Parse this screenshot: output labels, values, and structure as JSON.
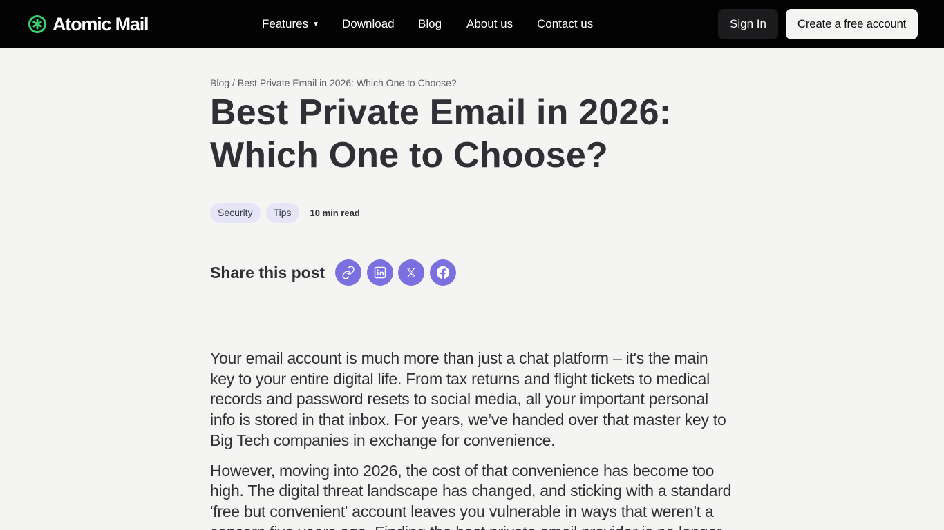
{
  "header": {
    "brand_name": "Atomic Mail",
    "brand_color": "#3ccf6e",
    "nav": [
      {
        "label": "Features",
        "icon": "caret-down-icon"
      },
      {
        "label": "Download"
      },
      {
        "label": "Blog"
      },
      {
        "label": "About us"
      },
      {
        "label": "Contact us"
      }
    ],
    "sign_in_label": "Sign In",
    "create_account_label": "Create a free account"
  },
  "breadcrumb": {
    "root": "Blog",
    "separator": "/",
    "current": "Best Private Email in 2026: Which One to Choose?"
  },
  "article": {
    "title": "Best Private Email in 2026: Which One to Choose?",
    "tags": [
      "Security",
      "Tips"
    ],
    "read_time": "10 min read",
    "share": {
      "label": "Share this post",
      "accent_color": "#7a70e0",
      "buttons": [
        "link-icon",
        "linkedin-icon",
        "x-icon",
        "facebook-icon"
      ]
    },
    "paragraphs": [
      "Your email account is much more than just a chat platform – it's the main key to your entire digital life. From tax returns and flight tickets to medical records and password resets to social media, all your important personal info is stored in that inbox. For years, we’ve handed over that master key to Big Tech companies in exchange for convenience.",
      "However, moving into 2026, the cost of that convenience has become too high. The digital threat landscape has changed, and sticking with a standard 'free but convenient' account leaves you vulnerable in ways that weren't a concern five years ago. Finding the best private email provider is no longer"
    ]
  }
}
